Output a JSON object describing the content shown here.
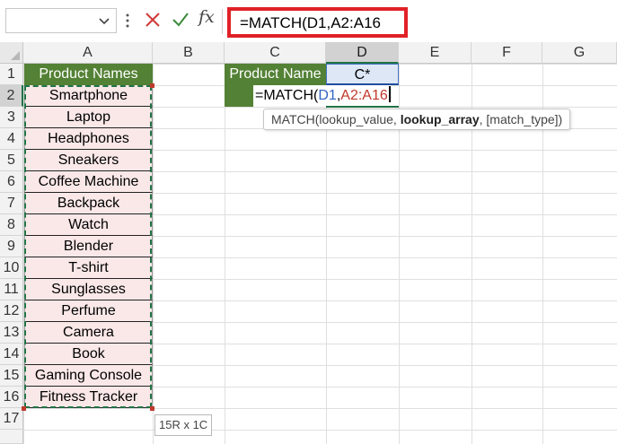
{
  "formula_bar": {
    "name_box_value": "",
    "fx_label": "fx",
    "formula_text": "=MATCH(D1,A2:A16"
  },
  "grid": {
    "columns": [
      "A",
      "B",
      "C",
      "D",
      "E",
      "F",
      "G"
    ],
    "rows": [
      "1",
      "2",
      "3",
      "4",
      "5",
      "6",
      "7",
      "8",
      "9",
      "10",
      "11",
      "12",
      "13",
      "14",
      "15",
      "16",
      "17"
    ]
  },
  "cells": {
    "A1": "Product Names",
    "C1": "Product Name",
    "D1": "C*",
    "products": [
      "Smartphone",
      "Laptop",
      "Headphones",
      "Sneakers",
      "Coffee Machine",
      "Backpack",
      "Watch",
      "Blender",
      "T-shirt",
      "Sunglasses",
      "Perfume",
      "Camera",
      "Book",
      "Gaming Console",
      "Fitness Tracker"
    ]
  },
  "edit": {
    "prefix": "=MATCH(",
    "ref1": "D1",
    "comma": ",",
    "ref2": "A2:A16"
  },
  "tooltip": {
    "arg1": "MATCH(lookup_value, ",
    "arg2": "lookup_array",
    "arg3": ", [match_type])"
  },
  "selection_size": "15R x 1C",
  "colors": {
    "header_green": "#538135",
    "product_fill": "#fae8e8",
    "lookup_fill": "#dde7f5",
    "formula_highlight": "#e02127"
  }
}
